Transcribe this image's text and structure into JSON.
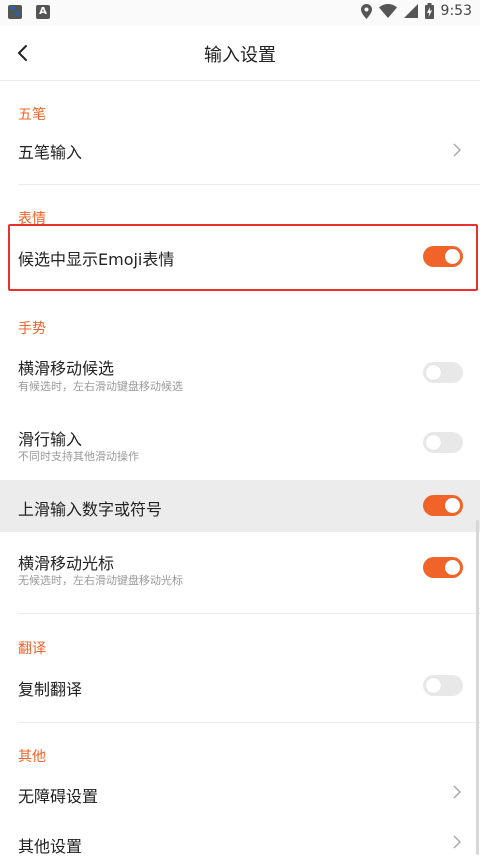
{
  "status_bar": {
    "time": "9:53",
    "left_icons": [
      "baidu-icon",
      "app-a-icon"
    ],
    "left_glyphs": [
      "🐾",
      "A"
    ],
    "right_icons": [
      "location-icon",
      "wifi-icon",
      "cellular-icon",
      "battery-charging-icon"
    ]
  },
  "header": {
    "title": "输入设置",
    "back_icon": "back-arrow-icon"
  },
  "colors": {
    "accent": "#f0642a",
    "highlight": "#e8322b",
    "toggle_off": "#e8e8e8"
  },
  "sections": {
    "wubi": {
      "header": "五笔",
      "input": {
        "label": "五笔输入",
        "icon": "chevron-right-icon"
      }
    },
    "emoji": {
      "header": "表情",
      "show_emoji": {
        "label": "候选中显示Emoji表情",
        "enabled": true
      }
    },
    "gesture": {
      "header": "手势",
      "swipe_candidate": {
        "label": "横滑移动候选",
        "sub": "有候选时，左右滑动键盘移动候选",
        "enabled": false
      },
      "slide_input": {
        "label": "滑行输入",
        "sub": "不同时支持其他滑动操作",
        "enabled": false
      },
      "swipe_up_symbols": {
        "label": "上滑输入数字或符号",
        "enabled": true
      },
      "swipe_cursor": {
        "label": "横滑移动光标",
        "sub": "无候选时，左右滑动键盘移动光标",
        "enabled": true
      }
    },
    "translate": {
      "header": "翻译",
      "copy_translate": {
        "label": "复制翻译",
        "enabled": false
      }
    },
    "other": {
      "header": "其他",
      "accessibility": {
        "label": "无障碍设置"
      },
      "other_settings": {
        "label": "其他设置"
      }
    }
  }
}
